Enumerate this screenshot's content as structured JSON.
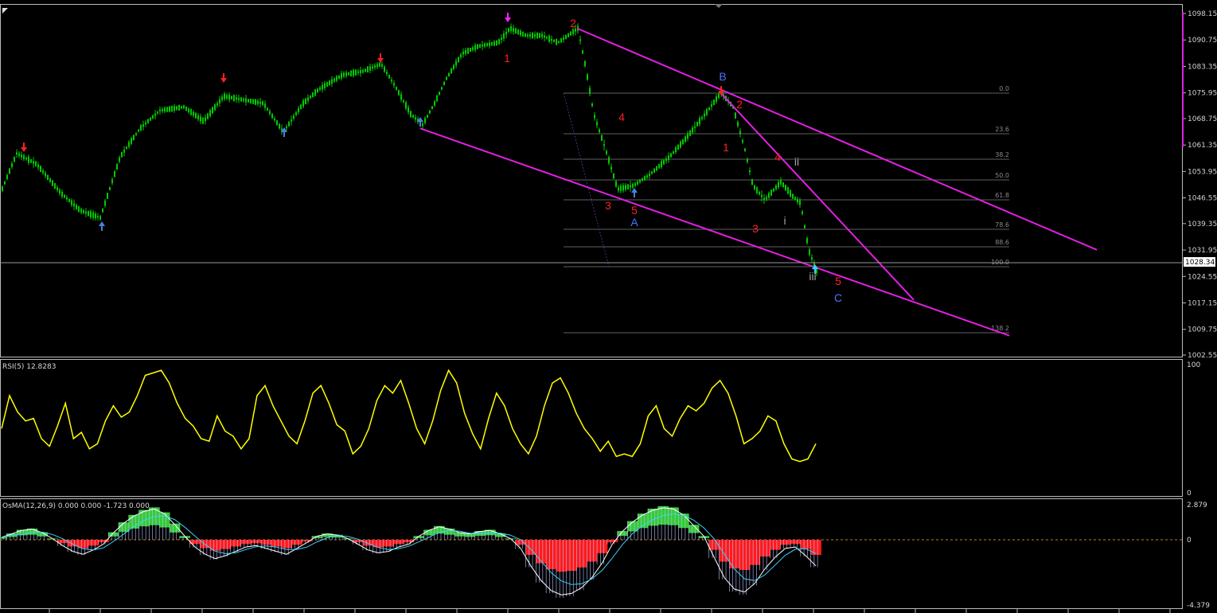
{
  "colors": {
    "background": "#000000",
    "bull_candle": "#00cc00",
    "channel": "#e020e0",
    "wave_red": "#ff2020",
    "wave_blue": "#5070ff",
    "rsi_line": "#ffff00",
    "osma_pos": "#33cc33",
    "osma_neg": "#ff1a1a",
    "osma_hatch": "#b8c4ff",
    "fib_line": "#606060",
    "price_line": "#a0a0a0"
  },
  "price_axis": {
    "ticks": [
      "1098.15",
      "1090.75",
      "1083.35",
      "1075.95",
      "1068.75",
      "1061.35",
      "1053.95",
      "1046.55",
      "1039.35",
      "1031.95",
      "1024.55",
      "1017.15",
      "1009.75",
      "1002.55"
    ],
    "current_price": "1028.34"
  },
  "fib_levels": [
    "0.0",
    "23.6",
    "38.2",
    "50.0",
    "61.8",
    "78.6",
    "88.6",
    "100.0",
    "138.2"
  ],
  "wave_labels": [
    {
      "text": "1",
      "color": "red"
    },
    {
      "text": "2",
      "color": "red"
    },
    {
      "text": "3",
      "color": "red"
    },
    {
      "text": "4",
      "color": "red"
    },
    {
      "text": "5",
      "color": "red"
    },
    {
      "text": "A",
      "color": "blue"
    },
    {
      "text": "B",
      "color": "blue"
    },
    {
      "text": "1",
      "color": "red"
    },
    {
      "text": "2",
      "color": "red"
    },
    {
      "text": "3",
      "color": "red"
    },
    {
      "text": "4",
      "color": "red"
    },
    {
      "text": "5",
      "color": "red"
    },
    {
      "text": "C",
      "color": "blue"
    },
    {
      "text": "i",
      "color": "gray"
    },
    {
      "text": "ii",
      "color": "gray"
    },
    {
      "text": "iii",
      "color": "gray"
    }
  ],
  "rsi": {
    "title": "RSI(5) 12.8283",
    "max": "100",
    "min": "0"
  },
  "osma": {
    "title": "OsMA(12,26,9) 0.000 0.000 -1.723 0.000",
    "max": "2.879",
    "zero": "0",
    "min": "-4.379"
  },
  "chart_data": {
    "type": "line",
    "title": "",
    "instrument_series_name": "",
    "price_range": [
      1002.55,
      1098.15
    ],
    "price_path": [
      [
        0,
        1048
      ],
      [
        20,
        1059
      ],
      [
        45,
        1056
      ],
      [
        75,
        1048
      ],
      [
        100,
        1043
      ],
      [
        125,
        1041
      ],
      [
        150,
        1058
      ],
      [
        175,
        1066
      ],
      [
        200,
        1071
      ],
      [
        230,
        1072
      ],
      [
        255,
        1068
      ],
      [
        280,
        1075
      ],
      [
        305,
        1074
      ],
      [
        330,
        1073
      ],
      [
        355,
        1065
      ],
      [
        380,
        1073
      ],
      [
        400,
        1077
      ],
      [
        430,
        1081
      ],
      [
        455,
        1082
      ],
      [
        478,
        1084
      ],
      [
        495,
        1078
      ],
      [
        515,
        1070
      ],
      [
        530,
        1067
      ],
      [
        545,
        1073
      ],
      [
        560,
        1080
      ],
      [
        580,
        1087
      ],
      [
        600,
        1089
      ],
      [
        625,
        1090
      ],
      [
        640,
        1094
      ],
      [
        660,
        1092
      ],
      [
        680,
        1092
      ],
      [
        700,
        1090
      ],
      [
        725,
        1094
      ],
      [
        735,
        1083
      ],
      [
        745,
        1070
      ],
      [
        760,
        1060
      ],
      [
        775,
        1049
      ],
      [
        795,
        1050
      ],
      [
        815,
        1053
      ],
      [
        840,
        1058
      ],
      [
        860,
        1063
      ],
      [
        885,
        1070
      ],
      [
        905,
        1076
      ],
      [
        920,
        1072
      ],
      [
        935,
        1060
      ],
      [
        945,
        1050
      ],
      [
        960,
        1046
      ],
      [
        980,
        1051
      ],
      [
        995,
        1047
      ],
      [
        1005,
        1045
      ],
      [
        1015,
        1032
      ],
      [
        1025,
        1026
      ]
    ],
    "rsi_values": [
      52,
      78,
      65,
      58,
      60,
      44,
      38,
      54,
      72,
      44,
      49,
      36,
      40,
      58,
      70,
      61,
      65,
      78,
      94,
      96,
      98,
      88,
      72,
      60,
      54,
      44,
      42,
      62,
      50,
      46,
      36,
      44,
      78,
      86,
      70,
      58,
      46,
      40,
      58,
      80,
      86,
      72,
      55,
      50,
      32,
      38,
      52,
      74,
      86,
      80,
      90,
      72,
      52,
      40,
      58,
      82,
      98,
      88,
      64,
      48,
      36,
      60,
      80,
      70,
      52,
      40,
      32,
      46,
      70,
      88,
      92,
      80,
      64,
      52,
      44,
      34,
      42,
      30,
      32,
      30,
      40,
      62,
      70,
      52,
      46,
      60,
      70,
      66,
      72,
      84,
      90,
      80,
      62,
      40,
      44,
      50,
      62,
      58,
      40,
      28,
      26,
      28,
      40
    ],
    "osma_values": [
      0.2,
      0.5,
      0.8,
      0.9,
      0.6,
      0.1,
      -0.4,
      -0.8,
      -1.0,
      -0.7,
      -0.3,
      0.6,
      1.4,
      2.0,
      2.4,
      2.6,
      2.2,
      1.3,
      0.3,
      -0.5,
      -1.0,
      -1.3,
      -1.1,
      -0.8,
      -0.5,
      -0.4,
      -0.6,
      -0.8,
      -1.0,
      -0.6,
      -0.2,
      0.3,
      0.5,
      0.4,
      0.1,
      -0.3,
      -0.7,
      -0.9,
      -0.8,
      -0.5,
      -0.3,
      0.3,
      0.8,
      1.1,
      0.9,
      0.6,
      0.5,
      0.7,
      0.8,
      0.5,
      0.1,
      -0.6,
      -1.8,
      -2.8,
      -3.5,
      -3.8,
      -3.7,
      -3.3,
      -2.6,
      -1.6,
      -0.3,
      0.7,
      1.5,
      2.1,
      2.5,
      2.7,
      2.6,
      2.1,
      1.2,
      0.3,
      -1.2,
      -2.6,
      -3.4,
      -3.6,
      -3.0,
      -2.0,
      -1.2,
      -0.6,
      -0.5,
      -1.1,
      -1.8
    ],
    "channel_lines": [
      {
        "from": [
          528,
          1066
        ],
        "to": [
          1268,
          1008
        ]
      },
      {
        "from": [
          725,
          1094
        ],
        "to": [
          1378,
          1032
        ]
      },
      {
        "from": [
          905,
          1076
        ],
        "to": [
          1148,
          1018
        ]
      }
    ]
  }
}
